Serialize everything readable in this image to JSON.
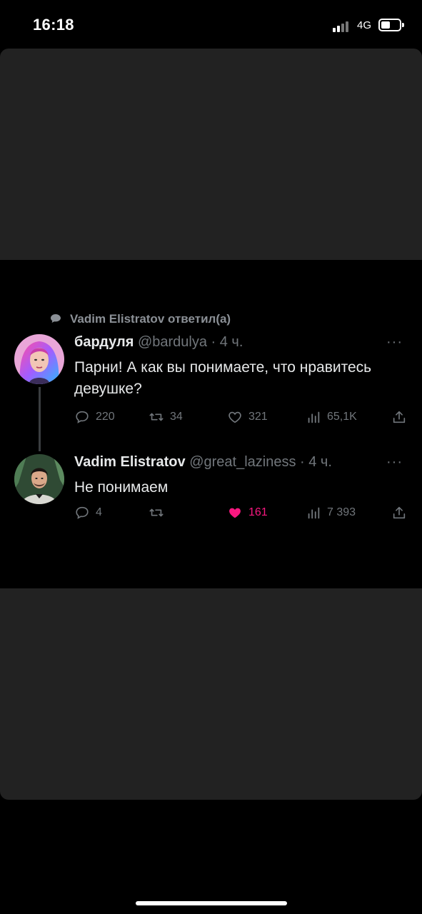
{
  "status_bar": {
    "time": "16:18",
    "network": "4G"
  },
  "reply_context": {
    "text": "Vadim Elistratov ответил(а)"
  },
  "tweets": [
    {
      "name": "бардуля",
      "handle": "@bardulya",
      "time": "· 4 ч.",
      "text": "Парни! А как вы понимаете, что нравитесь девушке?",
      "replies": "220",
      "retweets": "34",
      "likes": "321",
      "views": "65,1K"
    },
    {
      "name": "Vadim Elistratov",
      "handle": "@great_laziness",
      "time": "· 4 ч.",
      "text": "Не понимаем",
      "replies": "4",
      "retweets": "",
      "likes": "161",
      "views": "7 393"
    }
  ],
  "more_label": "···",
  "colors": {
    "like_active": "#f91880",
    "muted": "#71767b",
    "panel": "#222222"
  },
  "icons": [
    "reply-icon",
    "retweet-icon",
    "like-icon",
    "views-icon",
    "share-icon",
    "more-icon"
  ]
}
